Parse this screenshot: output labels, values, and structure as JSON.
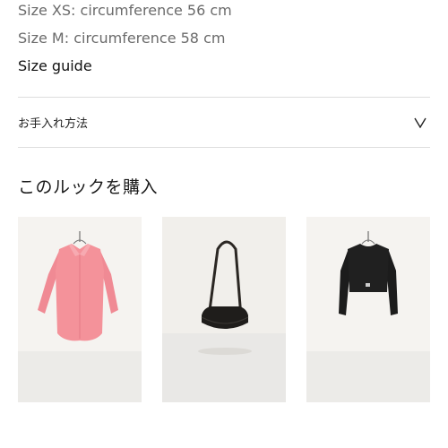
{
  "size_info": {
    "xs": "Size XS: circumference 56 cm",
    "m": "Size M: circumference 58 cm",
    "guide_link": "Size guide"
  },
  "care_accordion": {
    "label": "お手入れ方法",
    "icon": "chevron-down-icon",
    "expanded": false
  },
  "shop_the_look": {
    "title": "このルックを購入",
    "products": [
      {
        "image": "pink-shirt-on-hanger",
        "color": "#f2888f"
      },
      {
        "image": "black-crossbody-bag",
        "color": "#222222"
      },
      {
        "image": "black-cropped-cardigan-on-hanger",
        "color": "#1c1c1c"
      }
    ]
  },
  "colors": {
    "divider": "#dedede",
    "muted_text": "#6b6b6b",
    "card_background": "#f3f1ee"
  }
}
